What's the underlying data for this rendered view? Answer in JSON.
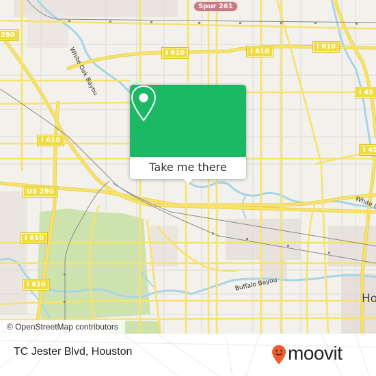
{
  "map": {
    "shields": {
      "spur261": "Spur 261",
      "i610_top_left": "I 610",
      "i610_top_mid": "I 610",
      "i610_top_right": "I 610",
      "i610_left_mid": "I 610",
      "i45_upper": "I 45",
      "i45_lower": "I 45",
      "us290_left_top": "290",
      "us290_mid": "US 290",
      "i610_left_low": "I 610",
      "i610_left_lower": "I 610"
    },
    "labels": {
      "white_oak_bayou_nw": "White Oak Bayou",
      "white_oak_bayou_e": "White Oak",
      "buffalo_bayou": "Buffalo Bayou",
      "houston_city": "Ho"
    },
    "colors": {
      "background": "#f2f1ec",
      "road": "#f7e26b",
      "road_casing": "#e8cc4a",
      "water": "#a8d4e6",
      "park": "#c8e0a8",
      "rail": "#888888",
      "urban": "#e6e0dc"
    }
  },
  "popup": {
    "icon": "location-pin-icon",
    "cta_label": "Take me there",
    "color": "#1db866"
  },
  "attribution": "© OpenStreetMap contributors",
  "footer": {
    "place_name": "TC Jester Blvd, Houston",
    "brand": "moovit",
    "brand_icon": "moovit-smiley-pin-icon",
    "brand_color": "#f15a2b"
  }
}
